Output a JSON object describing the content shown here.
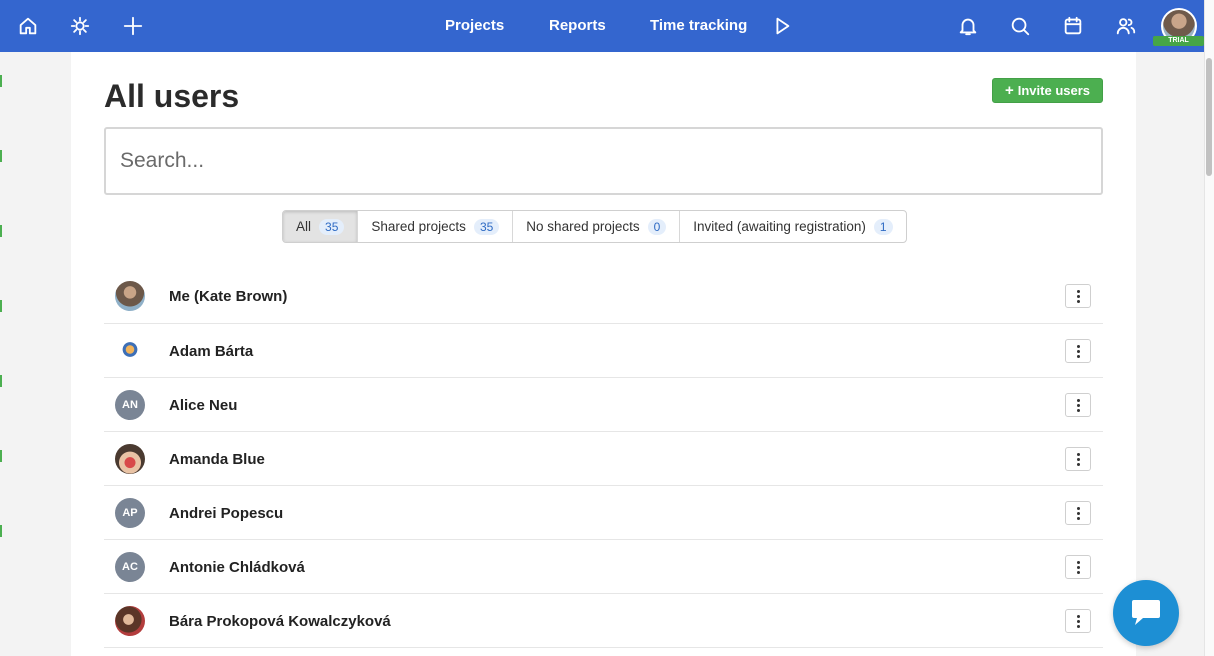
{
  "nav": {
    "links": {
      "projects": "Projects",
      "reports": "Reports",
      "time_tracking": "Time tracking"
    },
    "trial_badge": "TRIAL",
    "icons": [
      "home-icon",
      "settings-cog-icon",
      "plus-icon",
      "play-icon",
      "bell-icon",
      "search-icon",
      "calendar-icon",
      "users-icon"
    ]
  },
  "page": {
    "title": "All users",
    "invite_button": "Invite users"
  },
  "search": {
    "placeholder": "Search...",
    "value": ""
  },
  "filters": [
    {
      "label": "All",
      "count": "35",
      "active": true
    },
    {
      "label": "Shared projects",
      "count": "35",
      "active": false
    },
    {
      "label": "No shared projects",
      "count": "0",
      "active": false
    },
    {
      "label": "Invited (awaiting registration)",
      "count": "1",
      "active": false
    }
  ],
  "users": [
    {
      "name": "Me (Kate Brown)",
      "avatar": "photo",
      "initials": ""
    },
    {
      "name": "Adam Bárta",
      "avatar": "illustration",
      "initials": ""
    },
    {
      "name": "Alice Neu",
      "avatar": "initials",
      "initials": "AN"
    },
    {
      "name": "Amanda Blue",
      "avatar": "photo",
      "initials": ""
    },
    {
      "name": "Andrei Popescu",
      "avatar": "initials",
      "initials": "AP"
    },
    {
      "name": "Antonie Chládková",
      "avatar": "initials",
      "initials": "AC"
    },
    {
      "name": "Bára Prokopová Kowalczyková",
      "avatar": "photo",
      "initials": ""
    }
  ],
  "colors": {
    "nav_bg": "#3466cf",
    "invite_green": "#4caf50",
    "count_blue": "#2f6bc4",
    "chat_blue": "#1d8fd4",
    "initials_avatar": "#7a8595"
  }
}
